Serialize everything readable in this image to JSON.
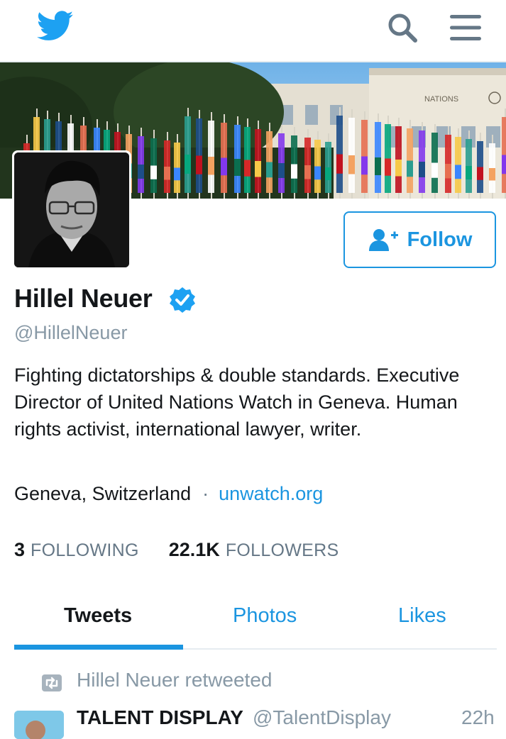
{
  "colors": {
    "accent": "#1b95e0",
    "muted": "#8899a6",
    "text": "#14171a",
    "border": "#e6ecf0"
  },
  "topbar": {
    "logo_icon": "twitter-bird-icon",
    "search_icon": "search-icon",
    "menu_icon": "hamburger-menu-icon"
  },
  "banner": {
    "sign_text": "NATIONS"
  },
  "profile": {
    "name": "Hillel Neuer",
    "verified_icon": "verified-badge-icon",
    "handle": "@HillelNeuer",
    "bio": "Fighting dictatorships & double standards. Executive Director of United Nations Watch in Geneva. Human rights activist, international lawyer, writer.",
    "location": "Geneva, Switzerland",
    "separator": "·",
    "website": "unwatch.org",
    "follow_label": "Follow",
    "follow_icon": "add-user-icon"
  },
  "stats": {
    "following_count": "3",
    "following_label": "FOLLOWING",
    "followers_count": "22.1K",
    "followers_label": "FOLLOWERS"
  },
  "tabs": [
    {
      "label": "Tweets",
      "active": true
    },
    {
      "label": "Photos",
      "active": false
    },
    {
      "label": "Likes",
      "active": false
    }
  ],
  "timeline": {
    "retweet_icon": "retweet-icon",
    "retweet_text": "Hillel Neuer retweeted",
    "tweet": {
      "author": "TALENT DISPLAY",
      "handle": "@TalentDisplay",
      "time": "22h"
    }
  }
}
